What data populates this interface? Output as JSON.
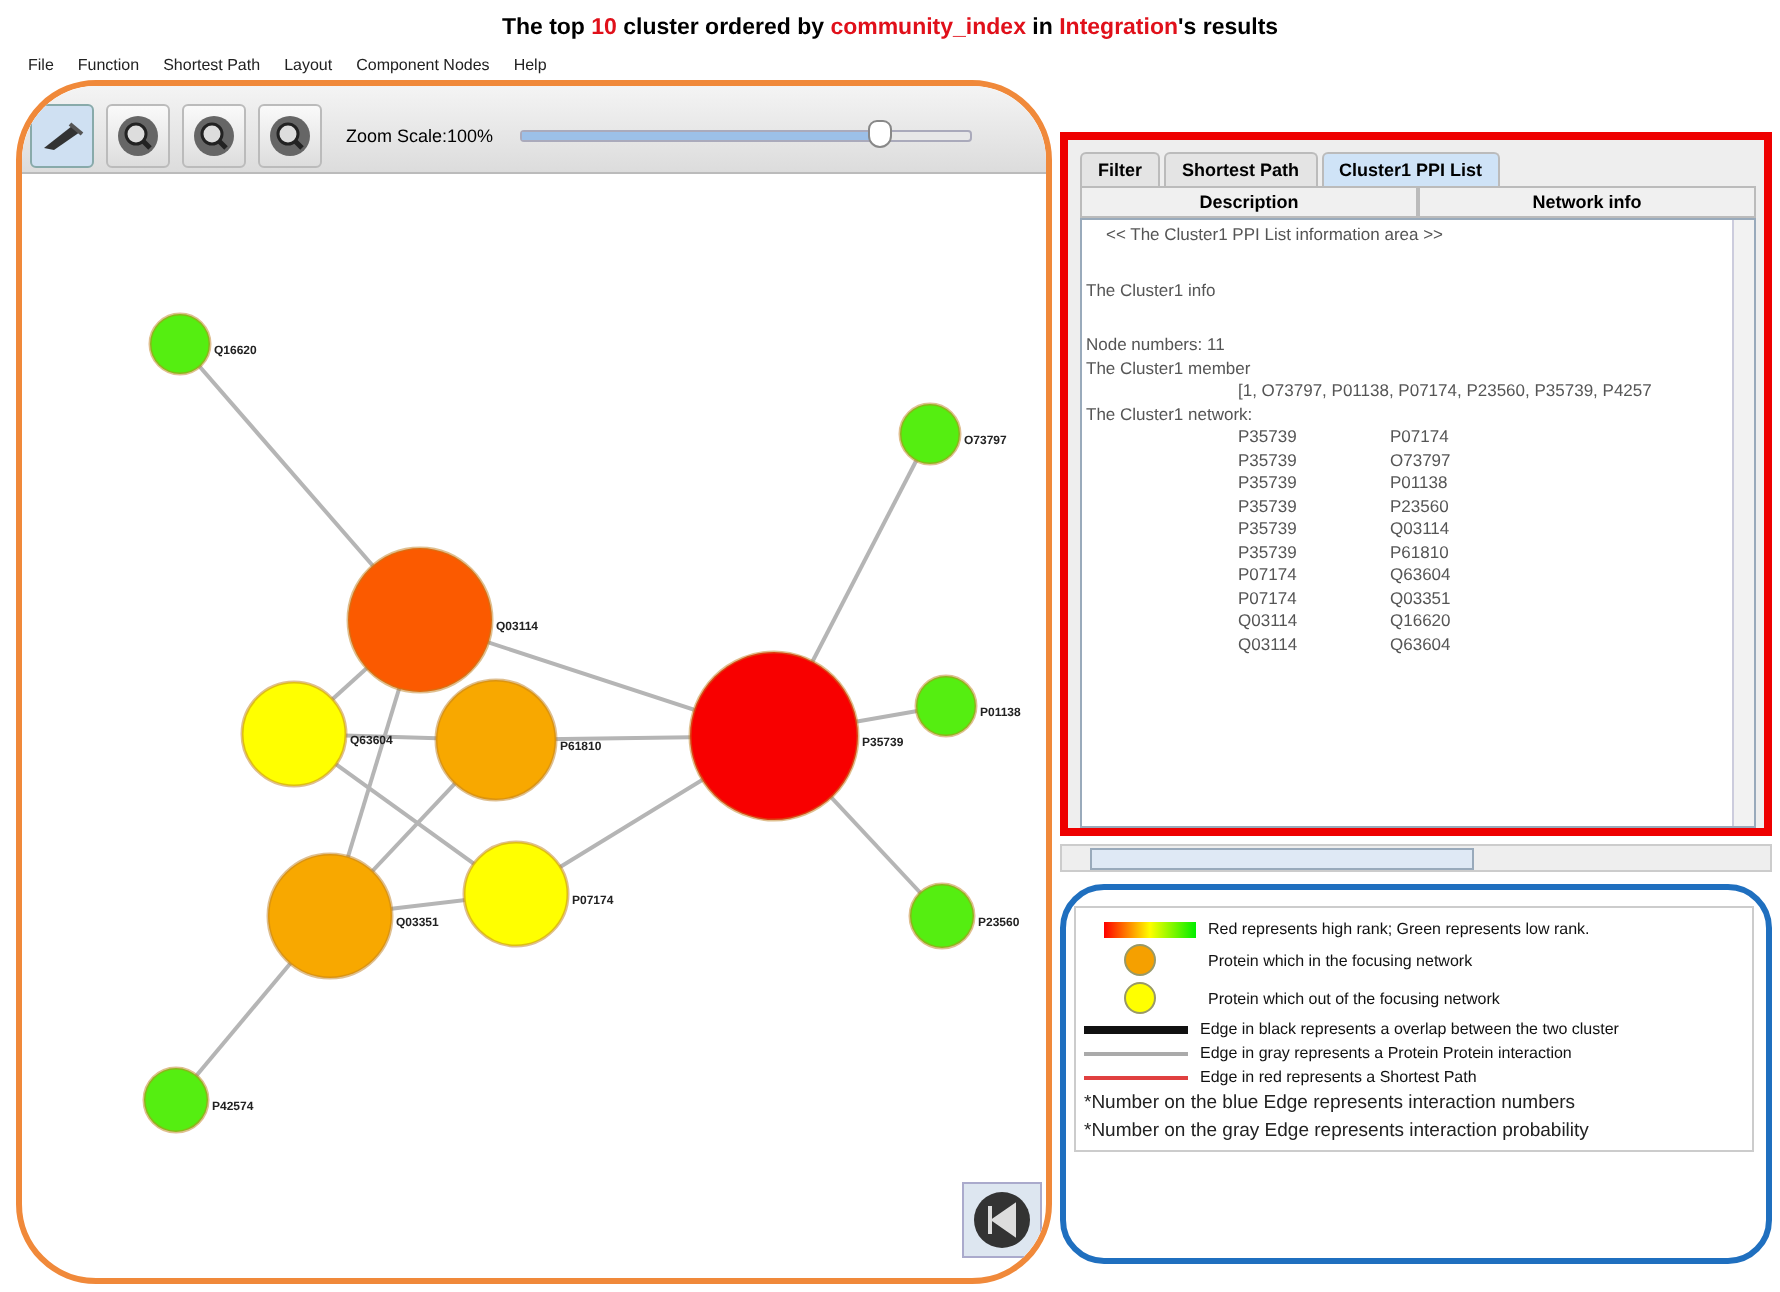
{
  "title": [
    {
      "text": "The top ",
      "highlight": false
    },
    {
      "text": "10",
      "highlight": true
    },
    {
      "text": " cluster ordered by ",
      "highlight": false
    },
    {
      "text": "community_index",
      "highlight": true
    },
    {
      "text": " in ",
      "highlight": false
    },
    {
      "text": "Integration",
      "highlight": true
    },
    {
      "text": "'s results",
      "highlight": false
    }
  ],
  "menu": [
    "File",
    "Function",
    "Shortest Path",
    "Layout",
    "Component Nodes",
    "Help"
  ],
  "toolbar": {
    "zoom_label": "Zoom Scale:100%",
    "zoom": {
      "level": 0.78
    }
  },
  "graph": {
    "nodes": [
      {
        "label": "Q16620",
        "color": "#55ee11"
      },
      {
        "label": "O73797",
        "color": "#55ee11"
      },
      {
        "label": "Q03114",
        "color": "#fb5a00"
      },
      {
        "label": "P35739",
        "color": "#f80000"
      },
      {
        "label": "P01138",
        "color": "#55ee11"
      },
      {
        "label": "Q63604",
        "color": "#ffff00"
      },
      {
        "label": "P61810",
        "color": "#f8a800"
      },
      {
        "label": "Q03351",
        "color": "#f8a800"
      },
      {
        "label": "P07174",
        "color": "#ffff00"
      },
      {
        "label": "P23560",
        "color": "#55ee11"
      },
      {
        "label": "P42574",
        "color": "#55ee11"
      }
    ]
  },
  "info_panel": {
    "tabs": [
      {
        "label": "Filter",
        "selected": false
      },
      {
        "label": "Shortest Path",
        "selected": false
      },
      {
        "label": "Cluster1 PPI List",
        "selected": true
      }
    ],
    "sub_tabs": [
      "Description",
      "Network info"
    ],
    "lines": [
      "<< The Cluster1 PPI List information area >>",
      "The Cluster1 info",
      "Node numbers: 11",
      "The Cluster1 member"
    ],
    "members": "[1, O73797, P01138, P07174, P23560, P35739, P4257",
    "network_heading": "The Cluster1 network:",
    "network": [
      [
        "P35739",
        "P07174"
      ],
      [
        "P35739",
        "O73797"
      ],
      [
        "P35739",
        "P01138"
      ],
      [
        "P35739",
        "P23560"
      ],
      [
        "P35739",
        "Q03114"
      ],
      [
        "P35739",
        "P61810"
      ],
      [
        "P07174",
        "Q63604"
      ],
      [
        "P07174",
        "Q03351"
      ],
      [
        "Q03114",
        "Q16620"
      ],
      [
        "Q03114",
        "Q63604"
      ]
    ]
  },
  "legend": {
    "items": [
      {
        "kind": "gradient",
        "text": "Red represents high rank; Green represents low rank."
      },
      {
        "kind": "circle",
        "color": "#f5a000",
        "text": "Protein which in the focusing network"
      },
      {
        "kind": "circle",
        "color": "#ffff00",
        "text": "Protein which out of the focusing network"
      },
      {
        "kind": "line",
        "color": "#111111",
        "text": "Edge in black represents a overlap between the two cluster"
      },
      {
        "kind": "line",
        "color": "#aaaaaa",
        "text": "Edge in gray represents a Protein Protein interaction"
      },
      {
        "kind": "line",
        "color": "#e04040",
        "text": "Edge in red represents a Shortest Path"
      },
      {
        "kind": "note",
        "text": "*Number on the blue Edge represents interaction numbers"
      },
      {
        "kind": "note",
        "text": "*Number on the gray Edge represents interaction probability"
      }
    ]
  }
}
